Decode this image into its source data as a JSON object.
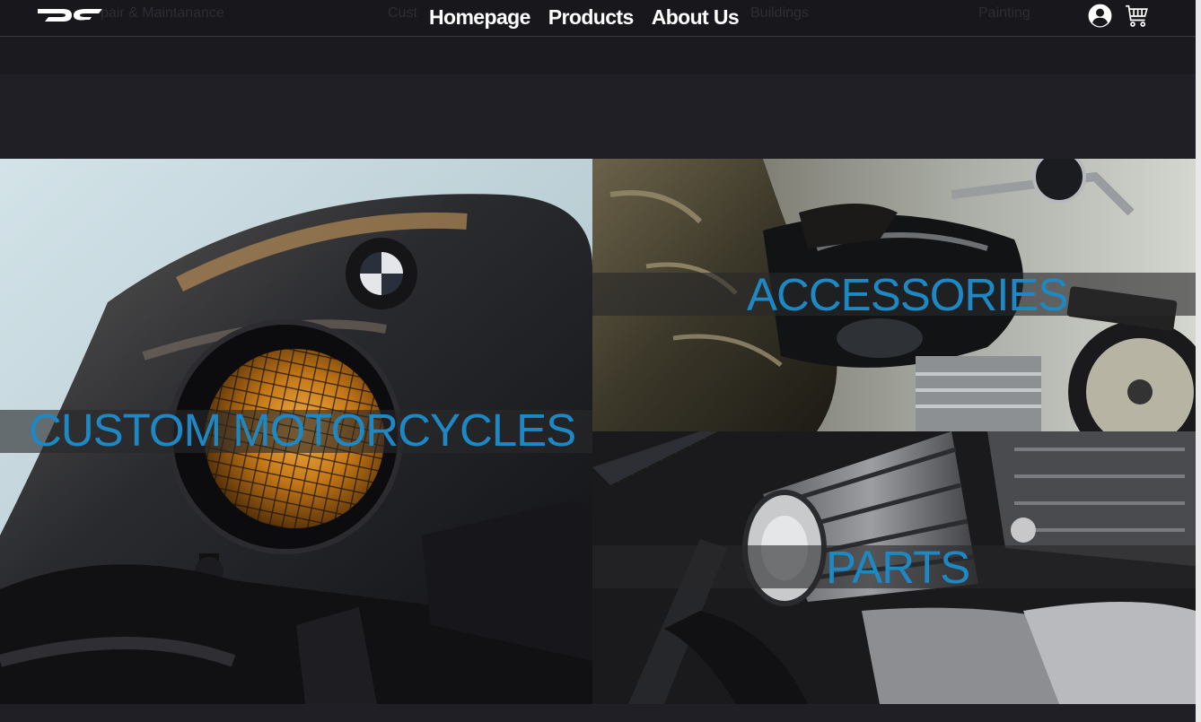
{
  "nav": {
    "links": [
      "Homepage",
      "Products",
      "About Us"
    ],
    "ghost_items": [
      "pair & Maintanance",
      "Cust",
      "Buildings",
      "Painting"
    ]
  },
  "categories": {
    "custom": "CUSTOM MOTORCYCLES",
    "accessories": "ACCESSORIES",
    "parts": "PARTS"
  },
  "colors": {
    "background": "#201f25",
    "nav": "#18171c",
    "accent": "#1e88c4",
    "text": "#ffffff"
  },
  "icons": {
    "logo": "dg-logo",
    "account": "user-circle-icon",
    "cart": "shopping-cart-icon"
  }
}
